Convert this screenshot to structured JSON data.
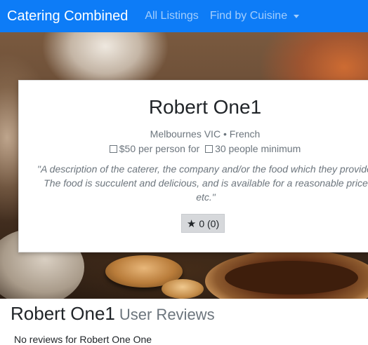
{
  "navbar": {
    "brand": "Catering Combined",
    "links": [
      {
        "label": "All Listings"
      },
      {
        "label": "Find by Cuisine"
      }
    ]
  },
  "caterer": {
    "name": "Robert One1",
    "meta": "Melbournes VIC • French",
    "price": "$50 per person for",
    "minimum": "30 people minimum",
    "description_lines": [
      "\"A description of the caterer, the company and/or the food which they provide.",
      "The food is succulent and delicious, and is available for a reasonable price",
      "etc.\""
    ],
    "rating_label": "0 (0)"
  },
  "reviews": {
    "title": "Robert One1",
    "subtitle": "User Reviews",
    "empty_message": "No reviews for Robert One One"
  },
  "icons": {
    "price": "checkbox-square-icon",
    "minimum": "checkbox-square-icon",
    "rating": "star-icon",
    "dropdown": "caret-down-icon"
  },
  "colors": {
    "navbar": "#0d7cf7",
    "muted_text": "#6c757d",
    "rating_button": "#d6d8db"
  }
}
